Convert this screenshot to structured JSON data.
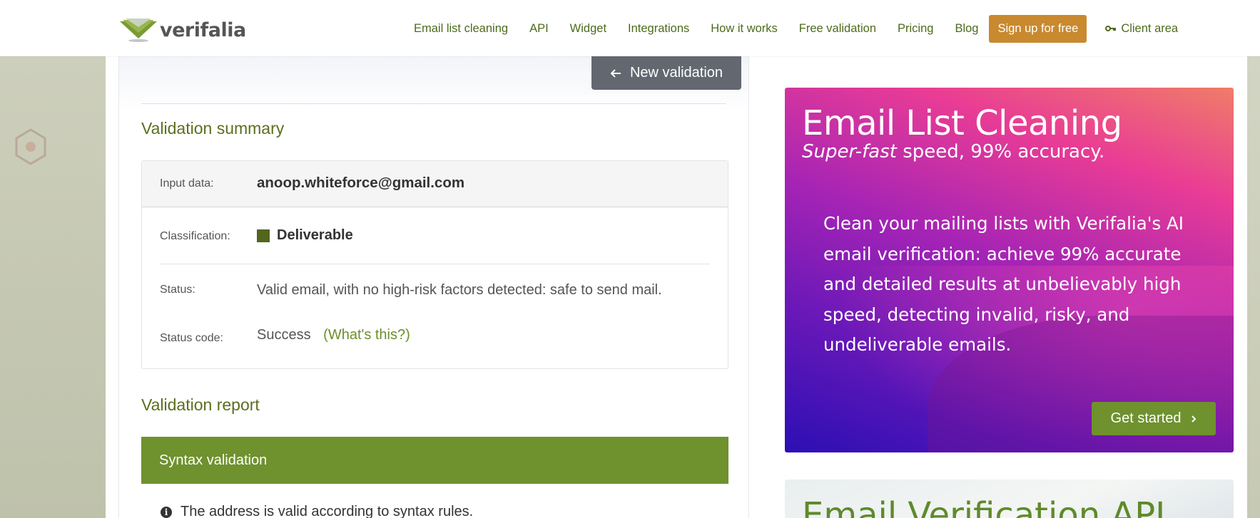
{
  "header": {
    "logo_text": "verifalia",
    "nav": [
      "Email list cleaning",
      "API",
      "Widget",
      "Integrations",
      "How it works",
      "Free validation",
      "Pricing",
      "Blog"
    ],
    "signup_label": "Sign up for free",
    "client_area_label": "Client area",
    "client_area_icon": "key-icon"
  },
  "colors": {
    "accent_green": "#6f912e",
    "signup_orange": "#c9892e",
    "nav_green": "#4d6b1c",
    "deliverable_square": "#52661e"
  },
  "main": {
    "new_validation_label": "New validation",
    "new_validation_icon": "arrow-left-icon",
    "summary_title": "Validation summary",
    "input_data_label": "Input data:",
    "input_data_value": "anoop.whiteforce@gmail.com",
    "classification_label": "Classification:",
    "classification_value": "Deliverable",
    "status_label": "Status:",
    "status_value": "Valid email, with no high-risk factors detected: safe to send mail.",
    "status_code_label": "Status code:",
    "status_code_value": "Success",
    "whats_this_label": "(What's this?)",
    "report_title": "Validation report",
    "syntax_section_label": "Syntax validation",
    "syntax_note": "The address is valid according to syntax rules."
  },
  "promo": {
    "title": "Email List Cleaning",
    "subtitle_em": "Super-fast",
    "subtitle_rest": " speed, 99% accuracy.",
    "body": "Clean your mailing lists with Verifalia's AI email verification: achieve 99% accurate and detailed results at unbelievably high speed, detecting invalid, risky, and undeliverable emails.",
    "cta_label": "Get started"
  },
  "promo2": {
    "title": "Email Verification API"
  }
}
